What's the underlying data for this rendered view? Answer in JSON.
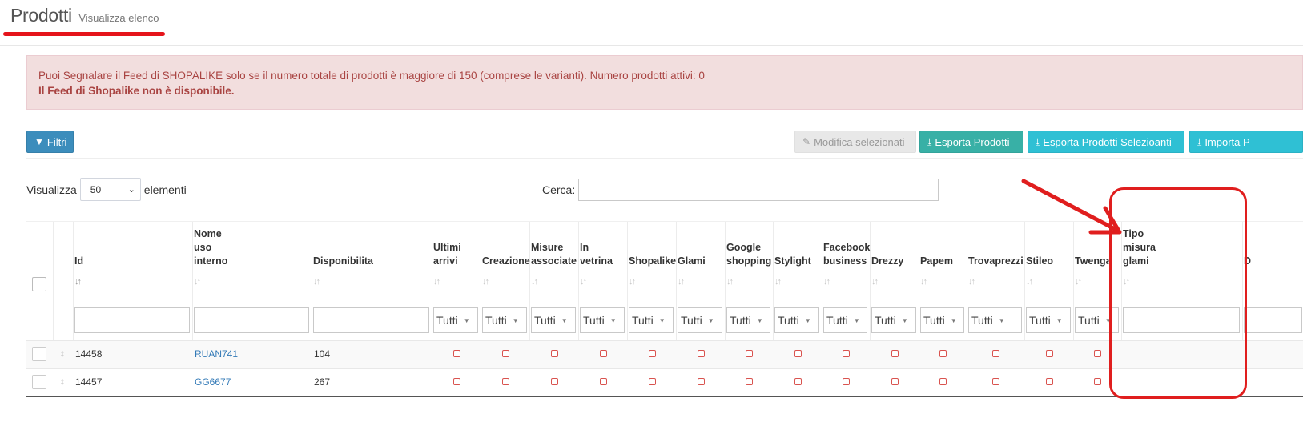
{
  "header": {
    "title": "Prodotti",
    "subtitle": "Visualizza elenco"
  },
  "alert": {
    "message": "Puoi Segnalare il Feed di SHOPALIKE solo se il numero totale di prodotti è maggiore di 150 (comprese le varianti). Numero prodotti attivi: 0",
    "strong": "Il Feed di Shopalike non è disponibile."
  },
  "toolbar": {
    "filter_label": "Filtri",
    "edit_selected_label": "Modifica selezionati",
    "export_label": "Esporta Prodotti",
    "export_selected_label": "Esporta Prodotti Selezioanti",
    "import_label": "Importa P"
  },
  "table_controls": {
    "show_label": "Visualizza",
    "page_length": "50",
    "elements_label": "elementi",
    "search_label": "Cerca:",
    "search_value": ""
  },
  "table": {
    "columns": [
      {
        "label": ""
      },
      {
        "label": ""
      },
      {
        "label": "Id"
      },
      {
        "label": "Nome\nuso\ninterno"
      },
      {
        "label": "Disponibilita"
      },
      {
        "label": "Ultimi\narrivi"
      },
      {
        "label": "Creazione"
      },
      {
        "label": "Misure\nassociate"
      },
      {
        "label": "In\nvetrina"
      },
      {
        "label": "Shopalike"
      },
      {
        "label": "Glami"
      },
      {
        "label": "Google\nshopping"
      },
      {
        "label": "Stylight"
      },
      {
        "label": "Facebook\nbusiness"
      },
      {
        "label": "Drezzy"
      },
      {
        "label": "Papem"
      },
      {
        "label": "Trovaprezzi"
      },
      {
        "label": "Stileo"
      },
      {
        "label": "Twenga"
      },
      {
        "label": "Tipo\nmisura\nglami"
      },
      {
        "label": "D"
      }
    ],
    "sort_icon": "↓↑",
    "filter_option": "Tutti",
    "rows": [
      {
        "id": "14458",
        "name": "RUAN741",
        "availability": "104"
      },
      {
        "id": "14457",
        "name": "GG6677",
        "availability": "267"
      }
    ]
  },
  "colors": {
    "annotation": "#e01e1e",
    "alert_bg": "#f2dede",
    "alert_text": "#a94442",
    "primary": "#3c8dbc",
    "export": "#38b0a6",
    "info": "#2fc0d4",
    "link": "#337ab7"
  }
}
